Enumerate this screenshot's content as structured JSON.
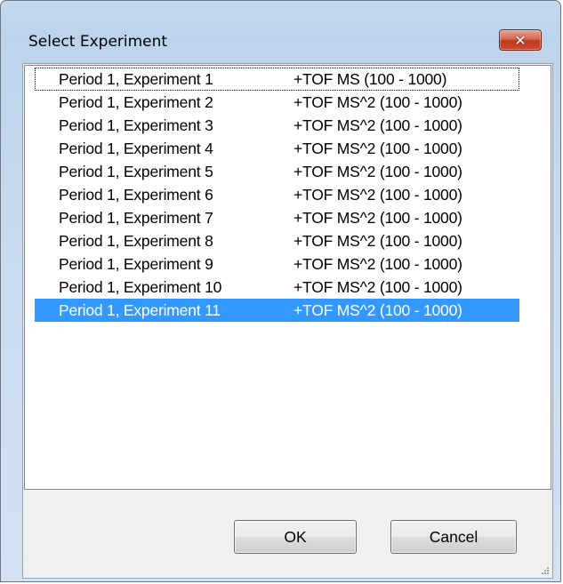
{
  "window": {
    "title": "Select Experiment",
    "close_glyph": "✕"
  },
  "experiments": [
    {
      "name": "Period 1, Experiment 1",
      "scan": "+TOF MS (100 - 1000)"
    },
    {
      "name": "Period 1, Experiment 2",
      "scan": "+TOF MS^2 (100 - 1000)"
    },
    {
      "name": "Period 1, Experiment 3",
      "scan": "+TOF MS^2 (100 - 1000)"
    },
    {
      "name": "Period 1, Experiment 4",
      "scan": "+TOF MS^2 (100 - 1000)"
    },
    {
      "name": "Period 1, Experiment 5",
      "scan": "+TOF MS^2 (100 - 1000)"
    },
    {
      "name": "Period 1, Experiment 6",
      "scan": "+TOF MS^2 (100 - 1000)"
    },
    {
      "name": "Period 1, Experiment 7",
      "scan": "+TOF MS^2 (100 - 1000)"
    },
    {
      "name": "Period 1, Experiment 8",
      "scan": "+TOF MS^2 (100 - 1000)"
    },
    {
      "name": "Period 1, Experiment 9",
      "scan": "+TOF MS^2 (100 - 1000)"
    },
    {
      "name": "Period 1, Experiment 10",
      "scan": "+TOF MS^2 (100 - 1000)"
    },
    {
      "name": "Period 1, Experiment 11",
      "scan": "+TOF MS^2 (100 - 1000)"
    }
  ],
  "focused_index": 0,
  "selected_index": 10,
  "buttons": {
    "ok_label": "OK",
    "cancel_label": "Cancel"
  },
  "colors": {
    "selection": "#3399ff",
    "close_button": "#c9492e"
  },
  "icons": {
    "close": "close-icon",
    "resize": "resize-grip-icon"
  }
}
